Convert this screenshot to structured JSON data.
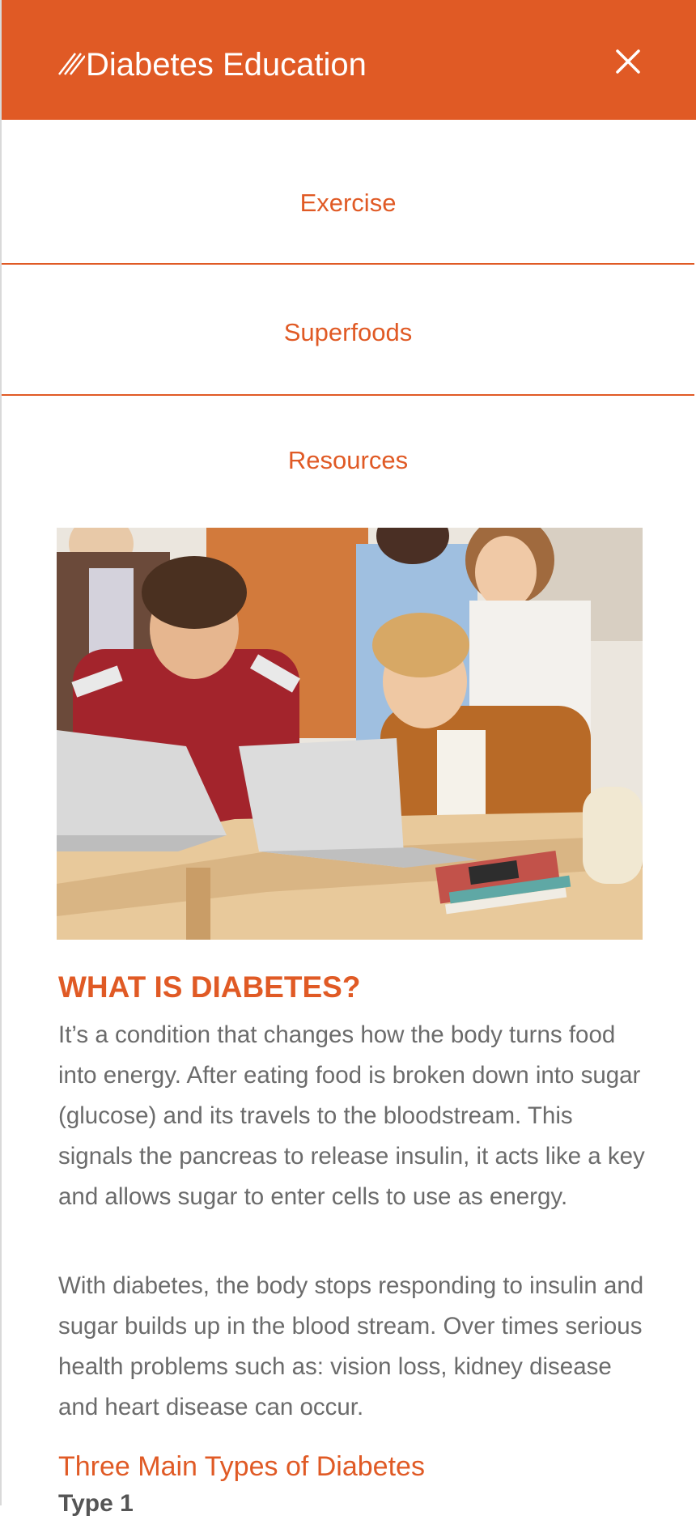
{
  "header": {
    "title": "Diabetes Education",
    "background_color": "#e05a25",
    "logo_icon": "slash-lines-icon",
    "close_icon": "close-icon"
  },
  "nav": {
    "items": [
      {
        "label": "Exercise"
      },
      {
        "label": "Superfoods"
      },
      {
        "label": "Resources"
      }
    ],
    "accent_color": "#e05a25"
  },
  "hero_image": {
    "subject": "students-with-laptops-photo"
  },
  "article": {
    "title": "WHAT IS DIABETES?",
    "paragraphs": [
      "It’s a condition that changes how the body turns food into energy. After eating food is broken down into sugar (glucose) and its travels to the bloodstream. This signals the pancreas to release insulin, it acts like a key and allows sugar to enter cells to use as energy.",
      "With diabetes, the body stops responding to insulin and sugar builds up in the blood stream. Over times serious health problems such as: vision loss, kidney disease and heart disease can occur."
    ],
    "subtitle": "Three Main Types of Diabetes",
    "next_heading": "Type 1"
  }
}
